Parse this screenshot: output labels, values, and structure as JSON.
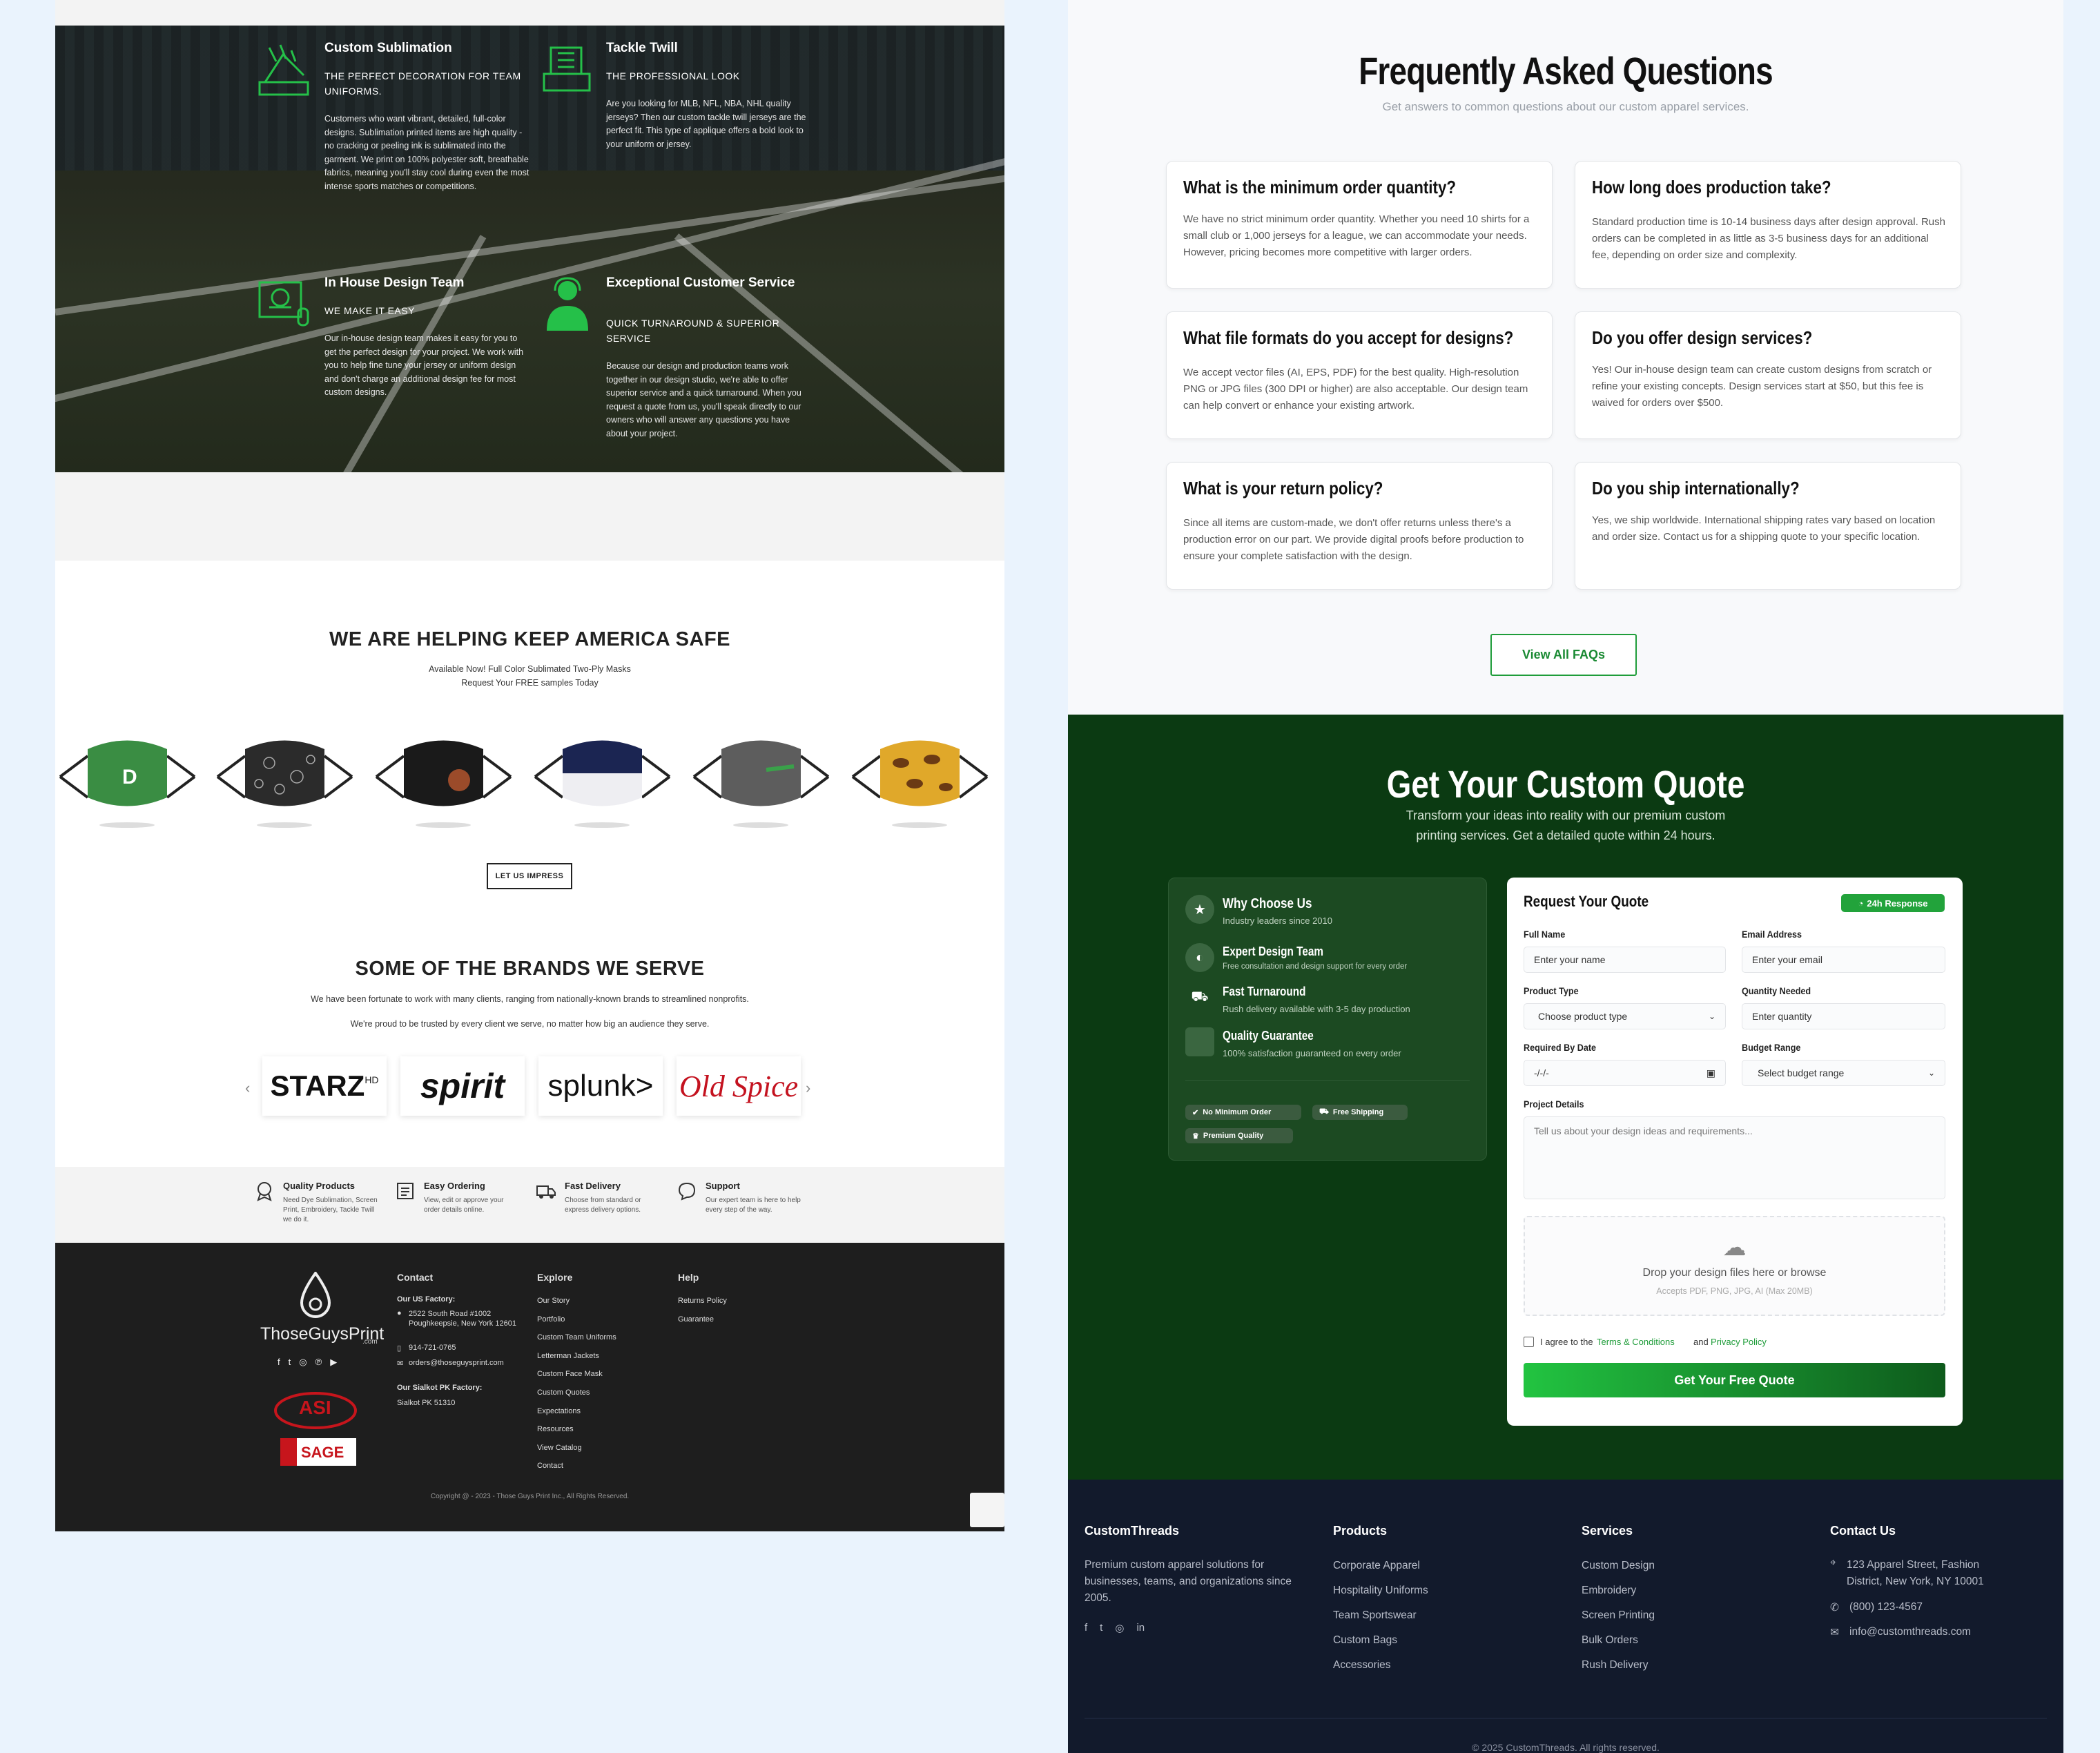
{
  "left": {
    "features": [
      {
        "title": "Custom Sublimation",
        "subtitle": "THE PERFECT DECORATION FOR TEAM UNIFORMS.",
        "body": "Customers who want vibrant, detailed, full-color designs. Sublimation printed items are high quality - no cracking or peeling ink is sublimated into the garment. We print on 100% polyester soft, breathable fabrics, meaning you'll stay cool during even the most intense sports matches or competitions."
      },
      {
        "title": "Tackle Twill",
        "subtitle": "THE PROFESSIONAL LOOK",
        "body": "Are you looking for MLB, NFL, NBA, NHL quality jerseys? Then our custom tackle twill jerseys are the perfect fit. This type of applique offers a bold look to your uniform or jersey."
      },
      {
        "title": "In House Design Team",
        "subtitle": "WE MAKE IT EASY",
        "body": "Our in-house design team makes it easy for you to get the perfect design for your project. We work with you to help fine tune your jersey or uniform design and don't charge an additional design fee for most custom designs."
      },
      {
        "title": "Exceptional Customer Service",
        "subtitle": "QUICK TURNAROUND & SUPERIOR SERVICE",
        "body": "Because our design and production teams work together in our design studio, we're able to offer superior service and a quick turnaround. When you request a quote from us, you'll speak directly to our owners who will answer any questions you have about your project."
      }
    ],
    "masks_title": "WE ARE HELPING KEEP AMERICA SAFE",
    "masks_sub1": "Available Now! Full Color Sublimated Two-Ply Masks",
    "masks_sub2": "Request Your FREE samples Today",
    "impress_button": "LET US IMPRESS",
    "brands_title": "SOME OF THE BRANDS WE SERVE",
    "brands_sub1": "We have been fortunate to work with many clients, ranging from nationally-known brands to streamlined nonprofits.",
    "brands_sub2": "We're proud to be trusted by every client we serve, no matter how big an audience they serve.",
    "brands": [
      "STARZ",
      "spirit",
      "splunk>",
      "Old Spice"
    ],
    "strip": [
      {
        "title": "Quality Products",
        "desc": "Need Dye Sublimation, Screen Print, Embroidery, Tackle Twill we do it."
      },
      {
        "title": "Easy Ordering",
        "desc": "View, edit or approve your order details online."
      },
      {
        "title": "Fast Delivery",
        "desc": "Choose from standard or express delivery options."
      },
      {
        "title": "Support",
        "desc": "Our expert team is here to help every step of the way."
      }
    ],
    "footer": {
      "logo": "ThoseGuysPrint",
      "logo_suffix": ".com",
      "contact_heading": "Contact",
      "us_factory": "Our US Factory:",
      "address": "2522 South Road #1002 Poughkeepsie, New York 12601",
      "phone": "914-721-0765",
      "email": "orders@thoseguysprint.com",
      "pk_factory": "Our Sialkot PK Factory:",
      "pk_address": "Sialkot PK 51310",
      "explore_heading": "Explore",
      "explore": [
        "Our Story",
        "Portfolio",
        "Custom Team Uniforms",
        "Letterman Jackets",
        "Custom Face Mask",
        "Custom Quotes",
        "Expectations",
        "Resources",
        "View Catalog",
        "Contact"
      ],
      "help_heading": "Help",
      "help": [
        "Returns Policy",
        "Guarantee"
      ],
      "asi_text": "ASI",
      "sage_text": "SAGE",
      "copyright": "Copyright @ - 2023 - Those Guys Print Inc., All Rights Reserved."
    }
  },
  "right": {
    "faq_title": "Frequently Asked Questions",
    "faq_sub": "Get answers to common questions about our custom apparel services.",
    "faqs": [
      {
        "q": "What is the minimum order quantity?",
        "a": "We have no strict minimum order quantity. Whether you need 10 shirts for a small club or 1,000 jerseys for a league, we can accommodate your needs. However, pricing becomes more competitive with larger orders."
      },
      {
        "q": "How long does production take?",
        "a": "Standard production time is 10-14 business days after design approval. Rush orders can be completed in as little as 3-5 business days for an additional fee, depending on order size and complexity."
      },
      {
        "q": "What file formats do you accept for designs?",
        "a": "We accept vector files (AI, EPS, PDF) for the best quality. High-resolution PNG or JPG files (300 DPI or higher) are also acceptable. Our design team can help convert or enhance your existing artwork."
      },
      {
        "q": "Do you offer design services?",
        "a": "Yes! Our in-house design team can create custom designs from scratch or refine your existing concepts. Design services start at $50, but this fee is waived for orders over $500."
      },
      {
        "q": "What is your return policy?",
        "a": "Since all items are custom-made, we don't offer returns unless there's a production error on our part. We provide digital proofs before production to ensure your complete satisfaction with the design."
      },
      {
        "q": "Do you ship internationally?",
        "a": "Yes, we ship worldwide. International shipping rates vary based on location and order size. Contact us for a shipping quote to your specific location."
      }
    ],
    "view_all": "View All FAQs",
    "quote_title": "Get Your Custom Quote",
    "quote_sub": "Transform your ideas into reality with our premium custom printing services. Get a detailed quote within 24 hours.",
    "why": {
      "title": "Why Choose Us",
      "tagline": "Industry leaders since 2010",
      "items": [
        {
          "title": "Expert Design Team",
          "desc": "Free consultation and design support for every order"
        },
        {
          "title": "Fast Turnaround",
          "desc": "Rush delivery available with 3-5 day production"
        },
        {
          "title": "Quality Guarantee",
          "desc": "100% satisfaction guaranteed on every order"
        }
      ],
      "pills": [
        "No Minimum Order",
        "Free Shipping",
        "Premium Quality"
      ]
    },
    "form": {
      "title": "Request Your Quote",
      "badge": "24h Response",
      "full_name_label": "Full Name",
      "full_name_ph": "Enter your name",
      "email_label": "Email Address",
      "email_ph": "Enter your email",
      "product_label": "Product Type",
      "product_value": "Choose product type",
      "qty_label": "Quantity Needed",
      "qty_ph": "Enter quantity",
      "date_label": "Required By Date",
      "date_value": "-/-/-",
      "budget_label": "Budget Range",
      "budget_value": "Select budget range",
      "details_label": "Project Details",
      "details_ph": "Tell us about your design ideas and requirements...",
      "drop_text": "Drop your design files here or browse",
      "drop_accept": "Accepts PDF, PNG, JPG, AI (Max 20MB)",
      "agree_text": "I agree to the",
      "terms_link": "Terms & Conditions",
      "and_text": "and",
      "privacy_link": "Privacy Policy",
      "submit": "Get Your Free Quote"
    },
    "footer": {
      "brand": "CustomThreads",
      "brand_desc": "Premium custom apparel solutions for businesses, teams, and organizations since 2005.",
      "products_heading": "Products",
      "products": [
        "Corporate Apparel",
        "Hospitality Uniforms",
        "Team Sportswear",
        "Custom Bags",
        "Accessories"
      ],
      "services_heading": "Services",
      "services": [
        "Custom Design",
        "Embroidery",
        "Screen Printing",
        "Bulk Orders",
        "Rush Delivery"
      ],
      "contact_heading": "Contact Us",
      "address": "123 Apparel Street, Fashion District, New York, NY 10001",
      "phone": "(800) 123-4567",
      "email": "info@customthreads.com",
      "copyright": "© 2025 CustomThreads. All rights reserved."
    }
  },
  "colors": {
    "accent_green": "#1f9d3a",
    "dark_green": "#0b3a12",
    "footer_navy": "#121a2c",
    "left_footer": "#1e1e1e"
  }
}
